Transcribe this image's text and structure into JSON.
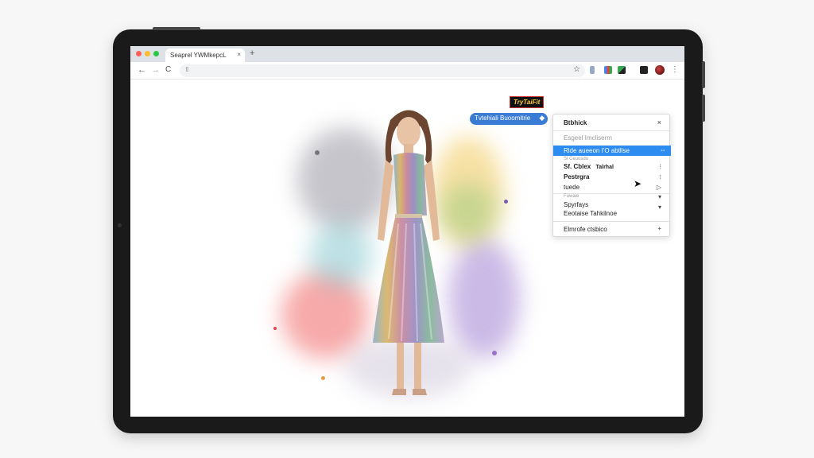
{
  "browser": {
    "tab_title": "Seaprel YWMkepcL",
    "tab_close": "×",
    "new_tab": "+",
    "nav": {
      "back": "←",
      "forward": "→",
      "reload": "C"
    },
    "lock_icon": "⇧",
    "bookmark_star": "☆",
    "menu_dots": "⋮",
    "traffic_colors": [
      "#ff5f57",
      "#febc2e",
      "#28c840"
    ]
  },
  "page": {
    "badge_text": "TryTaiFit",
    "tryon_button_label": "Tvtehiali Buoomitrie",
    "tryon_button_icon": "◆"
  },
  "context_menu": {
    "header": "Btbhick",
    "close": "×",
    "items": [
      {
        "label": "Esgeel Imcliserm",
        "muted": true
      },
      {
        "label": "Rlde aueeon I'O abtllse",
        "highlighted": true,
        "side": "⇔"
      },
      {
        "label": "Sl Ceuosdo",
        "muted": true,
        "small": true
      },
      {
        "label": "Sf. Cblex",
        "extra": "Talrhal",
        "bold": true,
        "side": "⁝"
      },
      {
        "label": "Pestrgra",
        "bold": true,
        "side": "⁝"
      },
      {
        "label": "tuede",
        "side": "▷"
      },
      {
        "label": "Fuwaie",
        "muted": true,
        "small": true,
        "side": "▾"
      },
      {
        "label": "Spyrfays"
      },
      {
        "label": "Eeotaise Tahkilnoe",
        "side": "▾"
      },
      {
        "label": "Elmrofe ctsbico",
        "side": "+"
      }
    ]
  },
  "colors": {
    "accent": "#2d8cf0",
    "button_blue": "#3a7bd5",
    "badge_bg": "#111111",
    "badge_text": "#ffcc33"
  }
}
